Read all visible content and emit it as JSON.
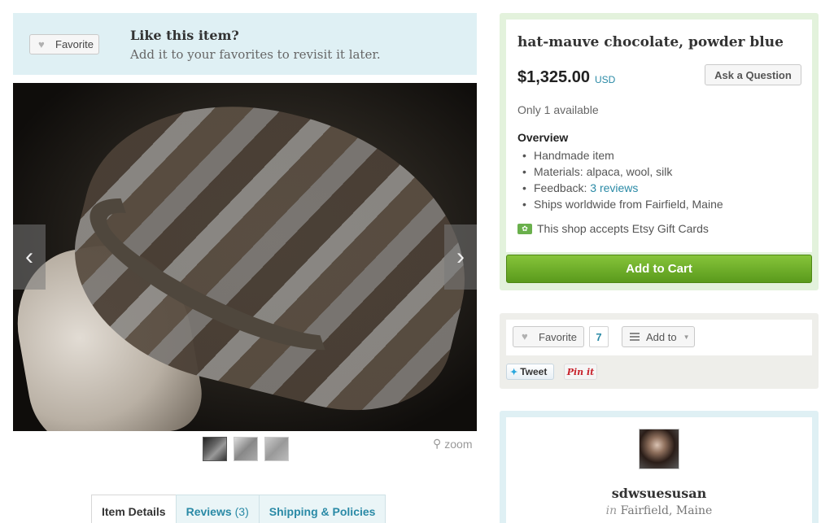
{
  "favorite_banner": {
    "button_label": "Favorite",
    "title": "Like this item?",
    "subtitle": "Add it to your favorites to revisit it later."
  },
  "gallery": {
    "zoom_label": "zoom",
    "thumbnail_count": 3
  },
  "tabs": [
    {
      "label": "Item Details",
      "count": ""
    },
    {
      "label": "Reviews",
      "count": "(3)"
    },
    {
      "label": "Shipping & Policies",
      "count": ""
    }
  ],
  "listing": {
    "title": "hat-mauve chocolate, powder blue",
    "price": "$1,325.00",
    "currency": "USD",
    "ask_button": "Ask a Question",
    "availability": "Only 1 available",
    "overview_heading": "Overview",
    "overview": {
      "handmade": "Handmade item",
      "materials": "Materials: alpaca, wool, silk",
      "feedback_prefix": "Feedback:",
      "feedback_link": "3 reviews",
      "ships": "Ships worldwide from Fairfield, Maine"
    },
    "gift_cards": "This shop accepts Etsy Gift Cards",
    "add_to_cart": "Add to Cart"
  },
  "social": {
    "favorite_label": "Favorite",
    "favorite_count": "7",
    "add_to_label": "Add to",
    "tweet_label": "Tweet",
    "pinit_label": "Pin it"
  },
  "shop": {
    "name": "sdwsuesusan",
    "location_prefix": "in",
    "location": "Fairfield, Maine"
  },
  "colors": {
    "accent_link": "#2a8aa6",
    "cart_green": "#6aae2a",
    "banner_blue": "#dff0f4"
  }
}
